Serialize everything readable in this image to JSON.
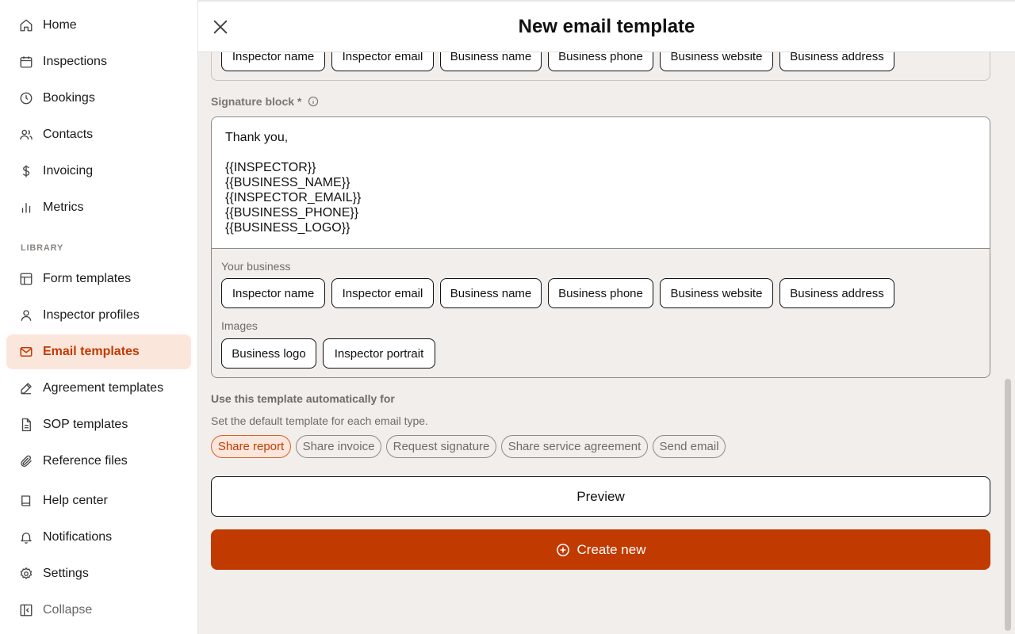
{
  "sidebar": {
    "items": [
      {
        "label": "Home",
        "icon": "home-icon"
      },
      {
        "label": "Inspections",
        "icon": "calendar-icon"
      },
      {
        "label": "Bookings",
        "icon": "clock-icon"
      },
      {
        "label": "Contacts",
        "icon": "users-icon"
      },
      {
        "label": "Invoicing",
        "icon": "dollar-icon"
      },
      {
        "label": "Metrics",
        "icon": "bar-chart-icon"
      }
    ],
    "library_label": "LIBRARY",
    "library_items": [
      {
        "label": "Form templates",
        "icon": "layout-icon"
      },
      {
        "label": "Inspector profiles",
        "icon": "user-icon"
      },
      {
        "label": "Email templates",
        "icon": "mail-icon"
      },
      {
        "label": "Agreement templates",
        "icon": "signature-icon"
      },
      {
        "label": "SOP templates",
        "icon": "document-icon"
      },
      {
        "label": "Reference files",
        "icon": "paperclip-icon"
      }
    ],
    "bottom_items": [
      {
        "label": "Help center",
        "icon": "book-icon"
      },
      {
        "label": "Notifications",
        "icon": "bell-icon"
      },
      {
        "label": "Settings",
        "icon": "gear-icon"
      },
      {
        "label": "Collapse",
        "icon": "collapse-icon"
      }
    ]
  },
  "header": {
    "title": "New email template"
  },
  "top_chips": [
    "Inspector name",
    "Inspector email",
    "Business name",
    "Business phone",
    "Business website",
    "Business address"
  ],
  "signature": {
    "label": "Signature block *",
    "lines": [
      "Thank you,",
      "",
      "{{INSPECTOR}}",
      "{{BUSINESS_NAME}}",
      "{{INSPECTOR_EMAIL}}",
      "{{BUSINESS_PHONE}}",
      "{{BUSINESS_LOGO}}"
    ],
    "your_business_label": "Your business",
    "business_chips": [
      "Inspector name",
      "Inspector email",
      "Business name",
      "Business phone",
      "Business website",
      "Business address"
    ],
    "images_label": "Images",
    "image_chips": [
      "Business logo",
      "Inspector portrait"
    ]
  },
  "auto": {
    "title": "Use this template automatically for",
    "subtitle": "Set the default template for each email type.",
    "options": [
      "Share report",
      "Share invoice",
      "Request signature",
      "Share service agreement",
      "Send email"
    ],
    "selected": "Share report"
  },
  "buttons": {
    "preview": "Preview",
    "create": "Create new"
  },
  "colors": {
    "accent": "#c13a00",
    "accent_light": "#fbe6dc",
    "background": "#f1eeec"
  }
}
